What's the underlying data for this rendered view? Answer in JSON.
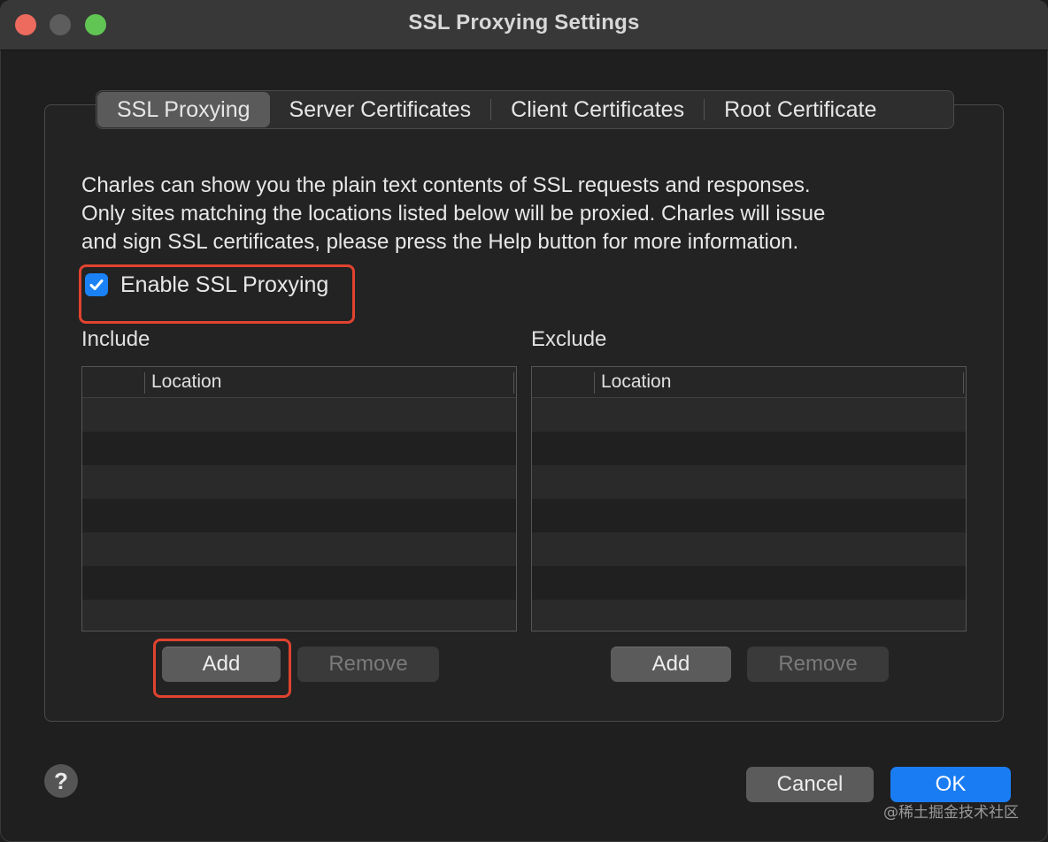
{
  "window": {
    "title": "SSL Proxying Settings"
  },
  "tabs": [
    {
      "label": "SSL Proxying",
      "active": true
    },
    {
      "label": "Server Certificates",
      "active": false
    },
    {
      "label": "Client Certificates",
      "active": false
    },
    {
      "label": "Root Certificate",
      "active": false
    }
  ],
  "description": [
    "Charles can show you the plain text contents of SSL requests and responses.",
    "Only sites matching the locations listed below will be proxied. Charles will issue",
    "and sign SSL certificates, please press the Help button for more information."
  ],
  "enable_ssl": {
    "label": "Enable SSL Proxying",
    "checked": true
  },
  "include": {
    "label": "Include",
    "column": "Location",
    "add": "Add",
    "remove": "Remove"
  },
  "exclude": {
    "label": "Exclude",
    "column": "Location",
    "add": "Add",
    "remove": "Remove"
  },
  "footer": {
    "help": "?",
    "cancel": "Cancel",
    "ok": "OK"
  },
  "watermark": "@稀土掘金技术社区",
  "colors": {
    "accent": "#1a7cf2",
    "highlight": "#e0432f"
  }
}
